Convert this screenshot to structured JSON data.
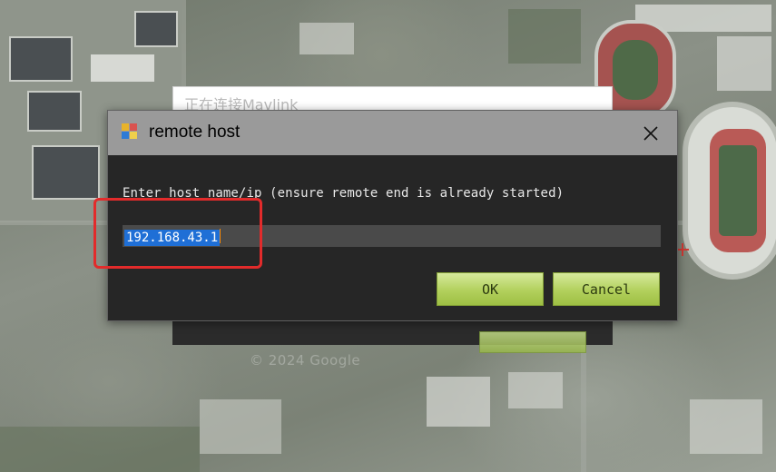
{
  "map": {
    "watermark": "© 2024 Google"
  },
  "background_window": {
    "title": "正在连接Mavlink"
  },
  "dialog": {
    "title": "remote host",
    "prompt": "Enter host name/ip (ensure remote end is already started)",
    "host_value": "192.168.43.1",
    "ok_label": "OK",
    "cancel_label": "Cancel",
    "close_icon": "close-icon",
    "app_icon": "app-icon"
  },
  "colors": {
    "titlebar": "#9a9a9a",
    "dialog_body": "#262626",
    "button": "#b2d05c",
    "selection": "#1f6fd6",
    "annotation": "#e22b2b"
  }
}
